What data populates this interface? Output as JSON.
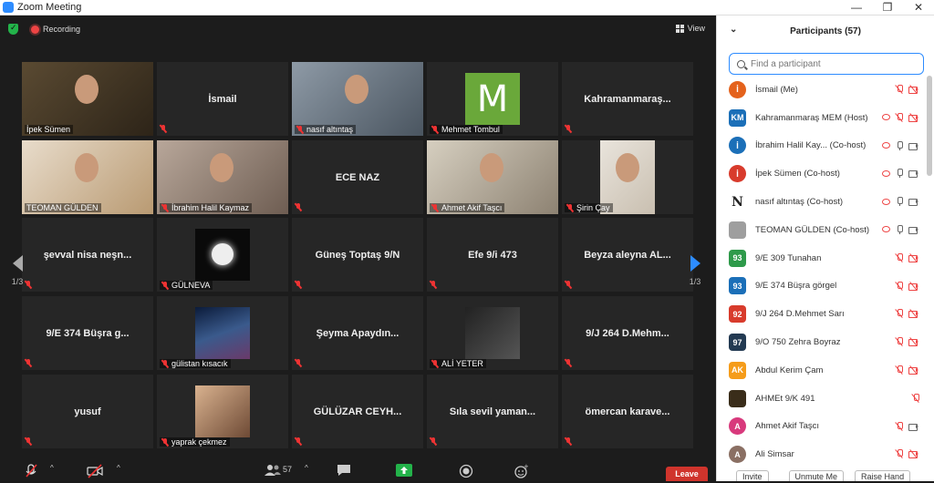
{
  "window": {
    "title": "Zoom Meeting",
    "controls": [
      "—",
      "❐",
      "✕"
    ]
  },
  "topbar": {
    "recording": "Recording",
    "view": "View"
  },
  "tiles": [
    {
      "label": "İpek Sümen",
      "name": "",
      "type": "video"
    },
    {
      "label": "",
      "name": "İsmail",
      "type": "name"
    },
    {
      "label": "nasıf altıntaş",
      "name": "",
      "type": "video"
    },
    {
      "label": "Mehmet Tombul",
      "name": "",
      "type": "letter",
      "letter": "M"
    },
    {
      "label": "",
      "name": "Kahramanmaraş...",
      "type": "name"
    },
    {
      "label": "TEOMAN GÜLDEN",
      "name": "",
      "type": "video"
    },
    {
      "label": "İbrahim Halil Kaymaz",
      "name": "",
      "type": "video"
    },
    {
      "label": "",
      "name": "ECE NAZ",
      "type": "name"
    },
    {
      "label": "Ahmet Akif Taşcı",
      "name": "",
      "type": "video"
    },
    {
      "label": "Şirin Çay",
      "name": "",
      "type": "video"
    },
    {
      "label": "",
      "name": "şevval nisa neşn...",
      "type": "name"
    },
    {
      "label": "GÜLNEVA",
      "name": "",
      "type": "pic"
    },
    {
      "label": "",
      "name": "Güneş Toptaş 9/N",
      "type": "name"
    },
    {
      "label": "",
      "name": "Efe 9/i 473",
      "type": "name"
    },
    {
      "label": "",
      "name": "Beyza aleyna AL...",
      "type": "name"
    },
    {
      "label": "",
      "name": "9/E 374 Büşra g...",
      "type": "name"
    },
    {
      "label": "gülistan kısacık",
      "name": "",
      "type": "pic"
    },
    {
      "label": "",
      "name": "Şeyma  Apaydın...",
      "type": "name"
    },
    {
      "label": "ALİ YETER",
      "name": "",
      "type": "pic"
    },
    {
      "label": "",
      "name": "9/J 264 D.Mehm...",
      "type": "name"
    },
    {
      "label": "",
      "name": "yusuf",
      "type": "name"
    },
    {
      "label": "yaprak çekmez",
      "name": "",
      "type": "pic"
    },
    {
      "label": "",
      "name": "GÜLÜZAR  CEYH...",
      "type": "name"
    },
    {
      "label": "",
      "name": "Sıla  sevil yaman...",
      "type": "name"
    },
    {
      "label": "",
      "name": "ömercan  karave...",
      "type": "name"
    }
  ],
  "pager": {
    "left": "1/3",
    "right": "1/3"
  },
  "toolbar": {
    "participants_count": "57",
    "leave": "Leave"
  },
  "participants_panel": {
    "title": "Participants (57)",
    "search_placeholder": "Find a participant",
    "rows": [
      {
        "initials": "İ",
        "color": "#e4621c",
        "name": "İsmail  (Me)",
        "rec": false,
        "mic": "off",
        "cam": "off"
      },
      {
        "initials": "KM",
        "color": "#1b6fb8",
        "name": "Kahramanmaraş MEM (Host)",
        "rec": true,
        "mic": "off",
        "cam": "off"
      },
      {
        "initials": "İ",
        "color": "#1b6fb8",
        "name": "İbrahim Halil Kay... (Co-host)",
        "rec": true,
        "mic": "on",
        "cam": "on"
      },
      {
        "initials": "İ",
        "color": "#d83b2c",
        "name": "İpek Sümen  (Co-host)",
        "rec": true,
        "mic": "on",
        "cam": "on"
      },
      {
        "initials": "N",
        "color": "#ffffff",
        "name": "nasıf altıntaş  (Co-host)",
        "rec": true,
        "mic": "on",
        "cam": "on"
      },
      {
        "initials": "",
        "color": "#9e9e9e",
        "name": "TEOMAN GÜLDEN  (Co-host)",
        "rec": true,
        "mic": "on",
        "cam": "on"
      },
      {
        "initials": "93",
        "color": "#2e9a4a",
        "name": "9/E 309 Tunahan",
        "rec": false,
        "mic": "off",
        "cam": "off"
      },
      {
        "initials": "93",
        "color": "#1b6fb8",
        "name": "9/E 374 Büşra görgel",
        "rec": false,
        "mic": "off",
        "cam": "off"
      },
      {
        "initials": "92",
        "color": "#d83b2c",
        "name": "9/J 264 D.Mehmet Sarı",
        "rec": false,
        "mic": "off",
        "cam": "off"
      },
      {
        "initials": "97",
        "color": "#233a52",
        "name": "9/O 750 Zehra Boyraz",
        "rec": false,
        "mic": "off",
        "cam": "off"
      },
      {
        "initials": "AK",
        "color": "#f59c1a",
        "name": "Abdul Kerim Çam",
        "rec": false,
        "mic": "off",
        "cam": "off"
      },
      {
        "initials": "",
        "color": "#3a2d1a",
        "name": "AHMEt 9/K 491",
        "rec": false,
        "mic": "off",
        "cam": "none"
      },
      {
        "initials": "A",
        "color": "#d8397c",
        "name": "Ahmet Akif Taşcı",
        "rec": false,
        "mic": "off",
        "cam": "on"
      },
      {
        "initials": "A",
        "color": "#8a6f63",
        "name": "Ali Simsar",
        "rec": false,
        "mic": "off",
        "cam": "off"
      }
    ],
    "buttons": [
      "Invite",
      "Unmute Me",
      "Raise Hand"
    ]
  }
}
